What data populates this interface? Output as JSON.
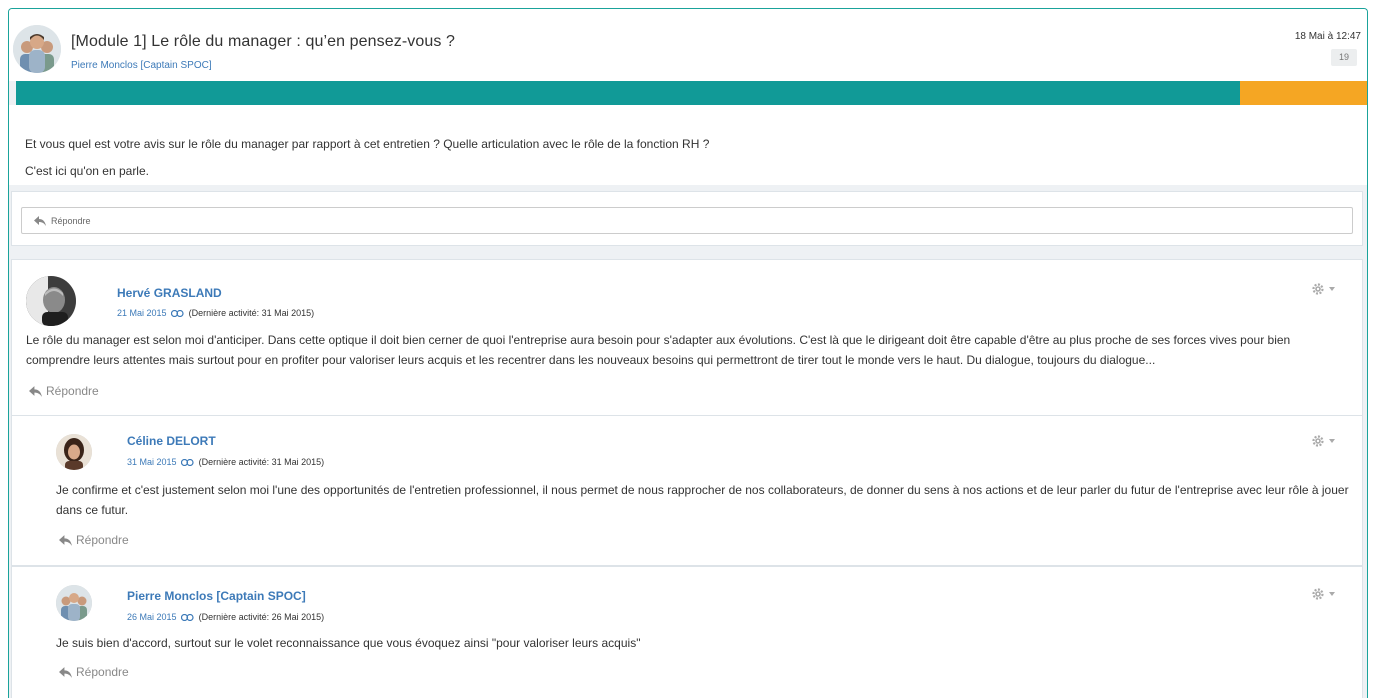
{
  "topic": {
    "title": "[Module 1] Le rôle du manager : qu’en pensez-vous ?",
    "author": "Pierre Monclos [Captain SPOC]",
    "date": "18 Mai à 12:47",
    "count": "19",
    "progress": 0.905,
    "colors": {
      "progress_fill": "#119a97",
      "progress_bg": "#f5a623",
      "link": "#3d7ab8"
    },
    "body": [
      "Et vous quel est votre avis sur le rôle du manager par rapport à cet entretien ? Quelle articulation avec le rôle de la fonction RH ?",
      "C'est ici qu'on en parle."
    ],
    "reply_label": "Répondre"
  },
  "posts": [
    {
      "author": "Hervé GRASLAND",
      "date": "21 Mai 2015",
      "last_activity": "(Dernière activité: 31 Mai 2015)",
      "text": "Le rôle du manager est selon moi d'anticiper. Dans cette optique il doit bien cerner de quoi l'entreprise aura besoin pour s'adapter aux évolutions. C'est là que le dirigeant doit être capable d'être au plus proche de ses forces vives pour bien comprendre leurs attentes mais surtout pour en profiter pour valoriser leurs acquis et les recentrer dans les nouveaux besoins qui permettront de tirer tout le monde vers le haut. Du dialogue, toujours du dialogue...",
      "reply_label": "Répondre"
    },
    {
      "author": "Céline DELORT",
      "date": "31 Mai 2015",
      "last_activity": "(Dernière activité: 31 Mai 2015)",
      "text": "Je confirme et c'est justement selon moi l'une des opportunités de l'entretien professionnel, il nous permet de nous rapprocher de nos collaborateurs, de donner du sens à nos actions et de leur parler du futur de l'entreprise avec leur rôle à jouer dans ce futur.",
      "reply_label": "Répondre"
    },
    {
      "author": "Pierre Monclos [Captain SPOC]",
      "date": "26 Mai 2015",
      "last_activity": "(Dernière activité: 26 Mai 2015)",
      "text": "Je suis bien d'accord, surtout sur le volet reconnaissance que vous évoquez ainsi \"pour valoriser leurs acquis\"",
      "reply_label": "Répondre"
    }
  ],
  "icons": {
    "reply": "reply-arrow-icon",
    "link": "link-icon",
    "gear": "gear-icon",
    "caret": "caret-down-icon"
  }
}
